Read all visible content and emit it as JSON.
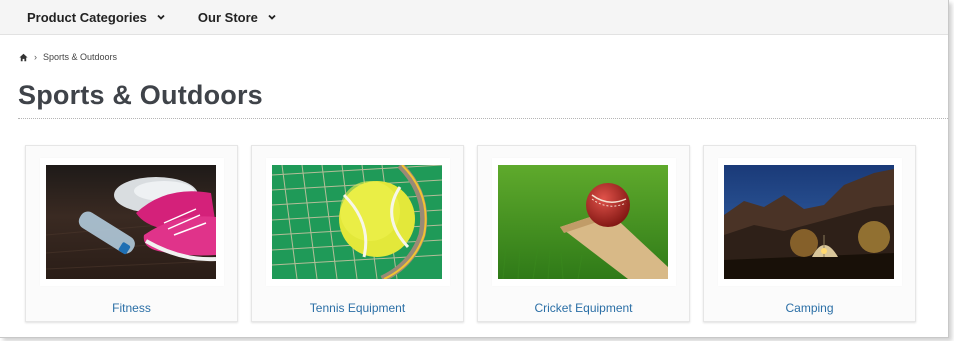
{
  "nav": {
    "items": [
      {
        "label": "Product Categories"
      },
      {
        "label": "Our Store"
      }
    ]
  },
  "breadcrumb": {
    "current": "Sports & Outdoors"
  },
  "page": {
    "title": "Sports & Outdoors"
  },
  "categories": [
    {
      "label": "Fitness",
      "image": "fitness-sneakers-water-bottle"
    },
    {
      "label": "Tennis Equipment",
      "image": "tennis-ball-racket"
    },
    {
      "label": "Cricket Equipment",
      "image": "cricket-ball-bat"
    },
    {
      "label": "Camping",
      "image": "tent-night-mountains"
    }
  ],
  "colors": {
    "link": "#2b6fa6",
    "title": "#3f4349",
    "nav_bg": "#f5f5f5"
  }
}
